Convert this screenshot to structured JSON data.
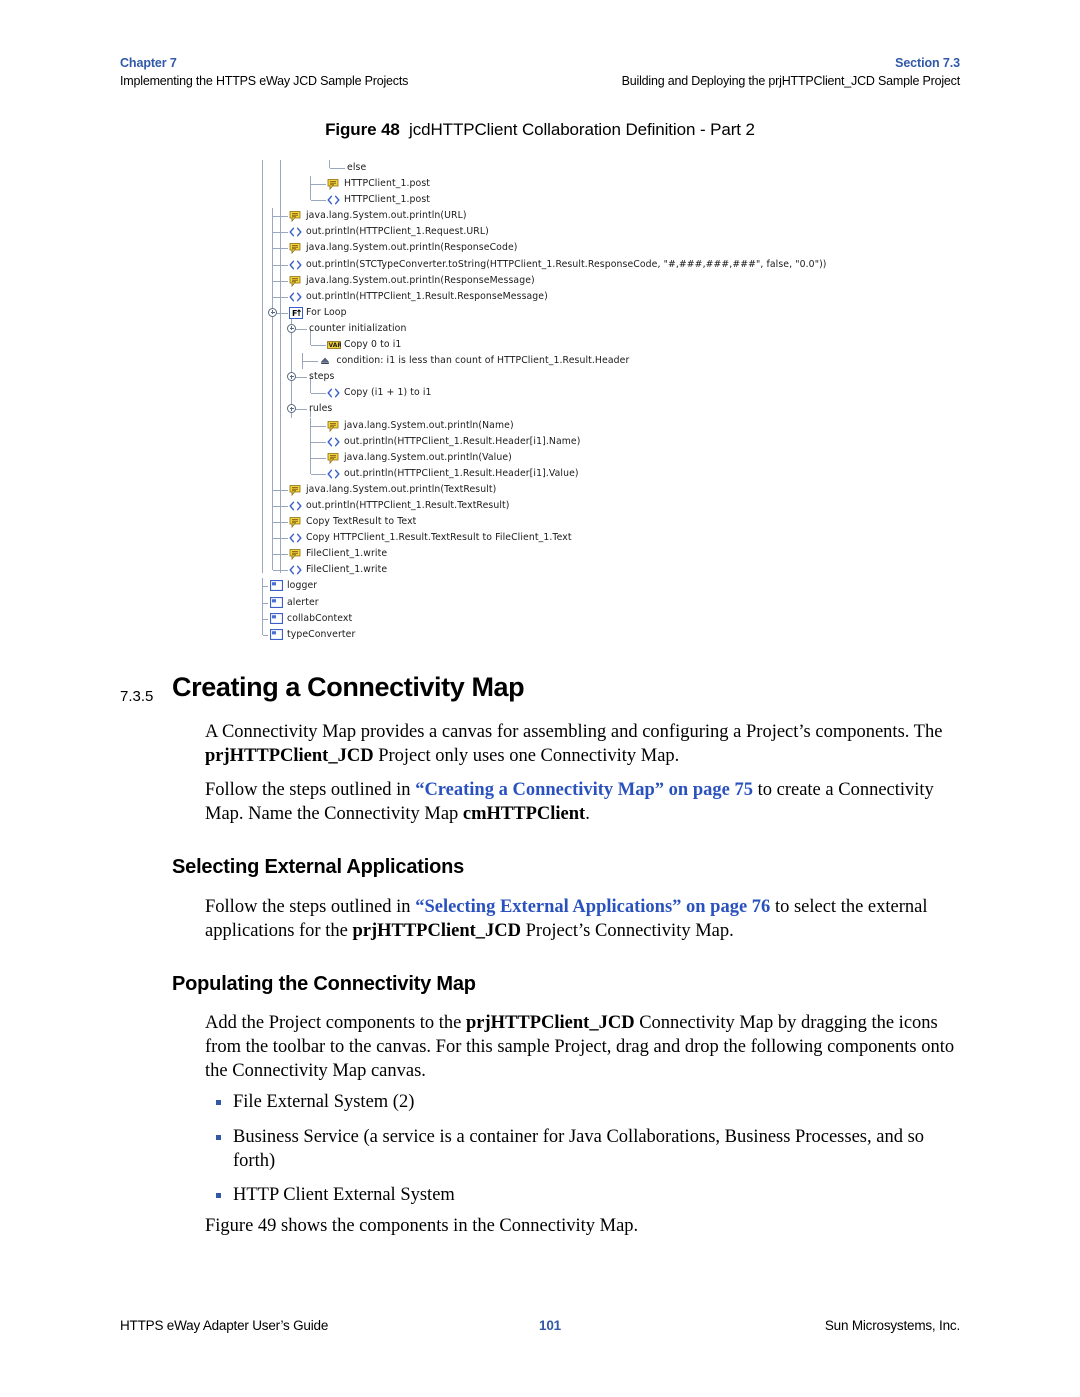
{
  "header": {
    "chapter_label": "Chapter 7",
    "chapter_subtitle": "Implementing the HTTPS eWay JCD Sample Projects",
    "section_label": "Section 7.3",
    "section_subtitle": "Building and Deploying the prjHTTPClient_JCD Sample Project"
  },
  "figure": {
    "number": "Figure 48",
    "title": "jcdHTTPClient Collaboration Definition - Part 2",
    "tree": [
      {
        "indent": 4,
        "icon": "none",
        "label": "else",
        "handle": false,
        "last": true
      },
      {
        "indent": 3,
        "icon": "comment",
        "label": "HTTPClient_1.post",
        "handle": false,
        "last": false
      },
      {
        "indent": 3,
        "icon": "codeblock",
        "label": "HTTPClient_1.post",
        "handle": false,
        "last": true
      },
      {
        "indent": 1,
        "icon": "comment",
        "label": "java.lang.System.out.println(URL)",
        "handle": false,
        "last": false
      },
      {
        "indent": 1,
        "icon": "codeblock",
        "label": "out.println(HTTPClient_1.Request.URL)",
        "handle": false,
        "last": false
      },
      {
        "indent": 1,
        "icon": "comment",
        "label": "java.lang.System.out.println(ResponseCode)",
        "handle": false,
        "last": false
      },
      {
        "indent": 1,
        "icon": "codeblock",
        "label": "out.println(STCTypeConverter.toString(HTTPClient_1.Result.ResponseCode, \"#,###,###,###\", false, \"0.0\"))",
        "handle": false,
        "last": false
      },
      {
        "indent": 1,
        "icon": "comment",
        "label": "java.lang.System.out.println(ResponseMessage)",
        "handle": false,
        "last": false
      },
      {
        "indent": 1,
        "icon": "codeblock",
        "label": "out.println(HTTPClient_1.Result.ResponseMessage)",
        "handle": false,
        "last": false
      },
      {
        "indent": 1,
        "icon": "forloop",
        "label": "For Loop",
        "handle": true,
        "last": false
      },
      {
        "indent": 2,
        "icon": "none",
        "label": "counter initialization",
        "handle": true,
        "last": false
      },
      {
        "indent": 3,
        "icon": "var",
        "label": "Copy 0 to i1",
        "handle": false,
        "last": true
      },
      {
        "indent": 2.6,
        "icon": "condition",
        "label": "condition: i1 is less than count of HTTPClient_1.Result.Header",
        "handle": false,
        "last": false
      },
      {
        "indent": 2,
        "icon": "none",
        "label": "steps",
        "handle": true,
        "last": false
      },
      {
        "indent": 3,
        "icon": "codeblock",
        "label": "Copy (i1 + 1) to i1",
        "handle": false,
        "last": true
      },
      {
        "indent": 2,
        "icon": "none",
        "label": "rules",
        "handle": true,
        "last": false
      },
      {
        "indent": 3,
        "icon": "comment",
        "label": "java.lang.System.out.println(Name)",
        "handle": false,
        "last": false
      },
      {
        "indent": 3,
        "icon": "codeblock",
        "label": "out.println(HTTPClient_1.Result.Header[i1].Name)",
        "handle": false,
        "last": false
      },
      {
        "indent": 3,
        "icon": "comment",
        "label": "java.lang.System.out.println(Value)",
        "handle": false,
        "last": false
      },
      {
        "indent": 3,
        "icon": "codeblock",
        "label": "out.println(HTTPClient_1.Result.Header[i1].Value)",
        "handle": false,
        "last": true
      },
      {
        "indent": 1,
        "icon": "comment",
        "label": "java.lang.System.out.println(TextResult)",
        "handle": false,
        "last": false
      },
      {
        "indent": 1,
        "icon": "codeblock",
        "label": "out.println(HTTPClient_1.Result.TextResult)",
        "handle": false,
        "last": false
      },
      {
        "indent": 1,
        "icon": "comment",
        "label": "Copy TextResult to Text",
        "handle": false,
        "last": false
      },
      {
        "indent": 1,
        "icon": "codeblock",
        "label": "Copy HTTPClient_1.Result.TextResult to FileClient_1.Text",
        "handle": false,
        "last": false
      },
      {
        "indent": 1,
        "icon": "comment",
        "label": "FileClient_1.write",
        "handle": false,
        "last": false
      },
      {
        "indent": 1,
        "icon": "codeblock",
        "label": "FileClient_1.write",
        "handle": false,
        "last": true
      },
      {
        "indent": 0,
        "icon": "object",
        "label": "logger",
        "handle": false,
        "last": false
      },
      {
        "indent": 0,
        "icon": "object",
        "label": "alerter",
        "handle": false,
        "last": false
      },
      {
        "indent": 0,
        "icon": "object",
        "label": "collabContext",
        "handle": false,
        "last": false
      },
      {
        "indent": 0,
        "icon": "object",
        "label": "typeConverter",
        "handle": false,
        "last": true
      }
    ]
  },
  "section": {
    "number": "7.3.5",
    "title": "Creating a Connectivity Map",
    "para1_a": "A Connectivity Map provides a canvas for assembling and configuring a Project’s components. The ",
    "para1_bold": "prjHTTPClient_JCD",
    "para1_b": " Project only uses one Connectivity Map.",
    "para2_a": "Follow the steps outlined in ",
    "para2_xref": "“Creating a Connectivity Map” on page 75",
    "para2_b": " to create a Connectivity Map. Name the Connectivity Map ",
    "para2_bold": "cmHTTPClient",
    "para2_c": "."
  },
  "subsection1": {
    "title": "Selecting External Applications",
    "para_a": "Follow the steps outlined in ",
    "para_xref": "“Selecting External Applications” on page 76",
    "para_b": " to select the external applications for the ",
    "para_bold": "prjHTTPClient_JCD",
    "para_c": " Project’s Connectivity Map."
  },
  "subsection2": {
    "title": "Populating the Connectivity Map",
    "para_a": "Add the Project components to the ",
    "para_bold": "prjHTTPClient_JCD",
    "para_b": " Connectivity Map by dragging the icons from the toolbar to the canvas. For this sample Project, drag and drop the following components onto the Connectivity Map canvas.",
    "bullets": [
      "File External System (2)",
      "Business Service (a service is a container for Java Collaborations, Business Processes, and so forth)",
      "HTTP Client External System"
    ],
    "closing": "Figure 49 shows the components in the Connectivity Map."
  },
  "footer": {
    "left": "HTTPS eWay Adapter User’s Guide",
    "page": "101",
    "right": "Sun Microsystems, Inc."
  },
  "colors": {
    "accent_blue": "#3159a8",
    "xref_blue": "#2a52be",
    "tree_line": "#9aa7bd",
    "icon_yellow": "#f5d33a",
    "icon_blue": "#3a5fc8"
  }
}
